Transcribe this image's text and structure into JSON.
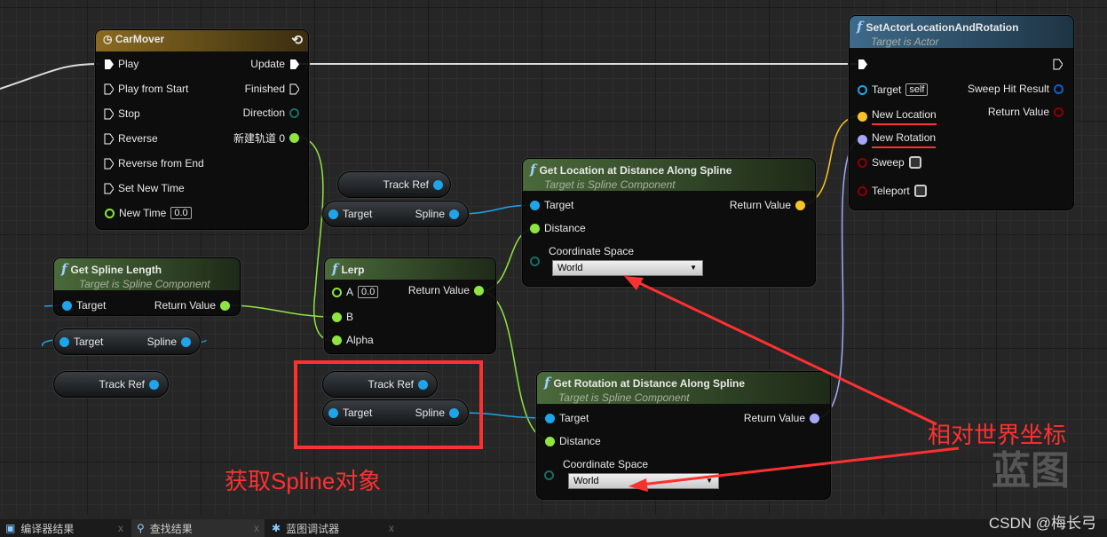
{
  "carmover": {
    "title": "CarMover",
    "inputs": [
      "Play",
      "Play from Start",
      "Stop",
      "Reverse",
      "Reverse from End",
      "Set New Time"
    ],
    "new_time_label": "New Time",
    "new_time_value": "0.0",
    "outputs": [
      "Update",
      "Finished",
      "Direction",
      "新建轨道 0"
    ]
  },
  "set_actor": {
    "title": "SetActorLocationAndRotation",
    "subtitle": "Target is Actor",
    "target": "Target",
    "target_value": "self",
    "new_location": "New Location",
    "new_rotation": "New Rotation",
    "sweep": "Sweep",
    "teleport": "Teleport",
    "sweep_hit": "Sweep Hit Result",
    "return_value": "Return Value",
    "sweep_checked": false,
    "teleport_checked": false
  },
  "get_location": {
    "title": "Get Location at Distance Along Spline",
    "subtitle": "Target is Spline Component",
    "target": "Target",
    "distance": "Distance",
    "coord": "Coordinate Space",
    "coord_value": "World",
    "return_value": "Return Value"
  },
  "get_rotation": {
    "title": "Get Rotation at Distance Along Spline",
    "subtitle": "Target is Spline Component",
    "target": "Target",
    "distance": "Distance",
    "coord": "Coordinate Space",
    "coord_value": "World",
    "return_value": "Return Value"
  },
  "spline_length": {
    "title": "Get Spline Length",
    "subtitle": "Target is Spline Component",
    "target": "Target",
    "return_value": "Return Value"
  },
  "lerp": {
    "title": "Lerp",
    "a": "A",
    "a_value": "0.0",
    "b": "B",
    "alpha": "Alpha",
    "return_value": "Return Value"
  },
  "pills": {
    "track_ref": "Track Ref",
    "target": "Target",
    "spline": "Spline"
  },
  "annotations": {
    "world": "相对世界坐标",
    "get_spline": "获取Spline对象",
    "watermark": "蓝图"
  },
  "tabs": [
    {
      "label": "编译器结果"
    },
    {
      "label": "查找结果"
    },
    {
      "label": "蓝图调试器"
    }
  ],
  "credit": "CSDN @梅长弓",
  "colors": {
    "exec": "#ffffff",
    "object": "#1fa4ea",
    "float": "#8ee53f",
    "vector": "#f7c325",
    "rotator": "#a3a8f7",
    "bool": "#8c0000",
    "annotation": "#ff3030"
  }
}
